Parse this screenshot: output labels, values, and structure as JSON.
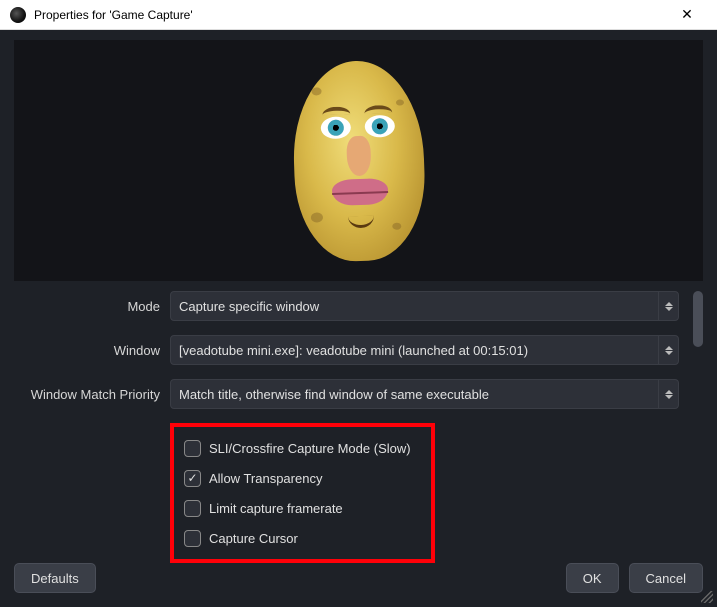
{
  "window": {
    "title": "Properties for 'Game Capture'"
  },
  "form": {
    "mode": {
      "label": "Mode",
      "value": "Capture specific window"
    },
    "window_sel": {
      "label": "Window",
      "value": "[veadotube mini.exe]: veadotube mini (launched at 00:15:01)"
    },
    "priority": {
      "label": "Window Match Priority",
      "value": "Match title, otherwise find window of same executable"
    },
    "checks": {
      "sli": {
        "label": "SLI/Crossfire Capture Mode (Slow)",
        "checked": false
      },
      "transparency": {
        "label": "Allow Transparency",
        "checked": true
      },
      "limit_fps": {
        "label": "Limit capture framerate",
        "checked": false
      },
      "cursor": {
        "label": "Capture Cursor",
        "checked": false
      }
    }
  },
  "buttons": {
    "defaults": "Defaults",
    "ok": "OK",
    "cancel": "Cancel"
  }
}
